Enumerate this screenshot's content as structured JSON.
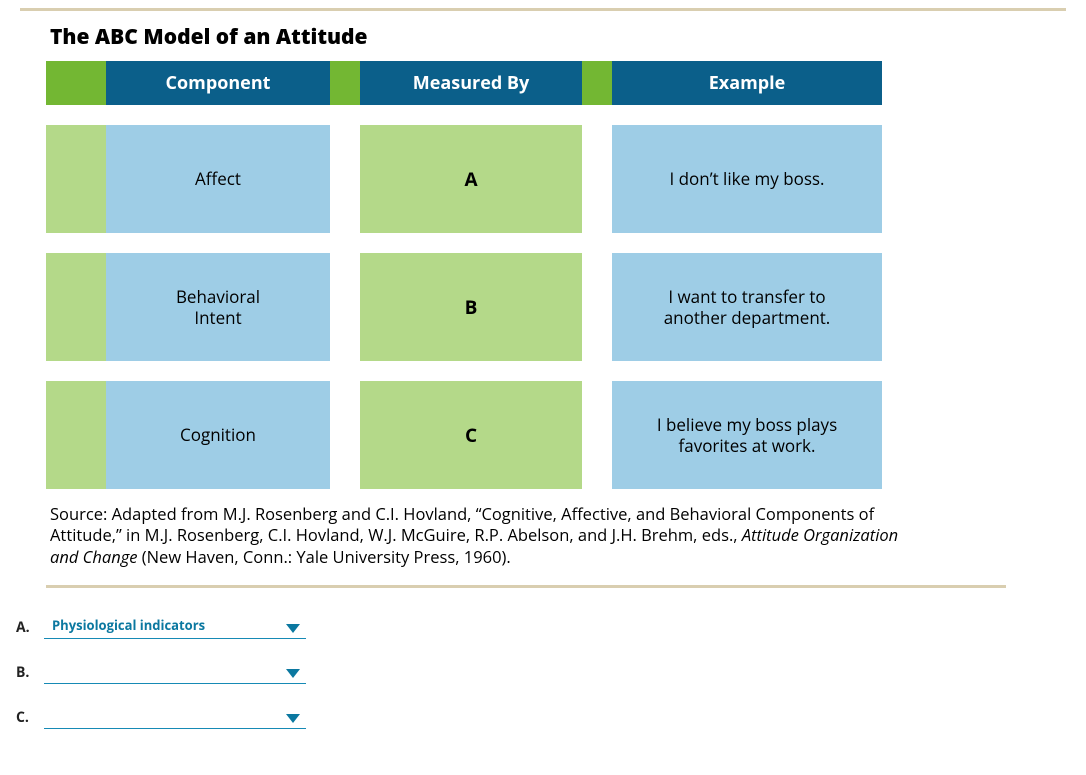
{
  "diagram": {
    "title": "The ABC Model of an Attitude",
    "headers": {
      "component": "Component",
      "measured_by": "Measured By",
      "example": "Example"
    },
    "rows": [
      {
        "component": "Affect",
        "measured_by_letter": "A",
        "example": "I don’t like my boss."
      },
      {
        "component": "Behavioral\nIntent",
        "measured_by_letter": "B",
        "example": "I want to transfer to\nanother department."
      },
      {
        "component": "Cognition",
        "measured_by_letter": "C",
        "example": "I believe my boss plays\nfavorites at work."
      }
    ],
    "source_prefix": "Source: Adapted from M.J. Rosenberg and C.I. Hovland, “Cognitive, Affective, and Behavioral Components of Attitude,” in M.J. Rosenberg, C.I. Hovland, W.J. McGuire, R.P. Abelson, and J.H. Brehm, eds., ",
    "source_italic": "Attitude Organization and Change",
    "source_suffix": " (New Haven, Conn.: Yale University Press, 1960)."
  },
  "answers": {
    "items": [
      {
        "label": "A.",
        "selected": "Physiological indicators"
      },
      {
        "label": "B.",
        "selected": ""
      },
      {
        "label": "C.",
        "selected": ""
      }
    ]
  }
}
